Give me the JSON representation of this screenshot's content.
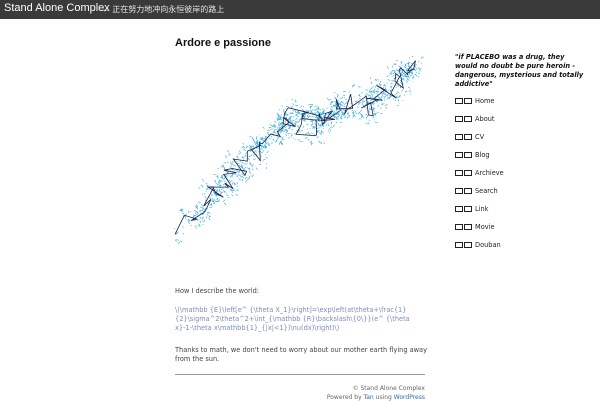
{
  "header": {
    "site_title": "Stand Alone Complex",
    "tagline": "← 正在努力地冲向永恒彼岸的路上"
  },
  "post": {
    "title": "Ardore e passione",
    "intro": "How I describe the world:",
    "formula": "\\(\\mathbb {E}\\left[e^ {\\theta X_1}\\right]=\\exp\\left(at\\theta+\\frac{1}{2}\\sigma^2\\theta^2+\\int_{\\mathbb {R}\\backslash\\{0\\}}(e^ {\\theta x}-1-\\theta x\\mathbb{1}_{|x|<1})\\nu(dx)\\right)\\)",
    "conclusion": "Thanks to math, we don't need to worry about our mother earth flying away from the sun."
  },
  "figure": {
    "line_color": "#1a1f4d",
    "scatter_color": "#29a8d6"
  },
  "sidebar": {
    "quote": "\"if PLACEBO was a drug, they would no doubt be pure heroin - dangerous, mysterious and totally addictive\"",
    "items": [
      {
        "label": "Home",
        "icon": "home-icon"
      },
      {
        "label": "About",
        "icon": "about-icon"
      },
      {
        "label": "CV",
        "icon": "cv-icon"
      },
      {
        "label": "Blog",
        "icon": "blog-icon"
      },
      {
        "label": "Archieve",
        "icon": "archive-icon"
      },
      {
        "label": "Search",
        "icon": "search-icon"
      },
      {
        "label": "Link",
        "icon": "link-icon"
      },
      {
        "label": "Movie",
        "icon": "movie-icon"
      },
      {
        "label": "Douban",
        "icon": "douban-icon"
      }
    ]
  },
  "footer": {
    "copyright": "© Stand Alone Complex",
    "powered_prefix": "Powered by",
    "theme_author": "Tan",
    "using": "using",
    "platform": "WordPress"
  }
}
